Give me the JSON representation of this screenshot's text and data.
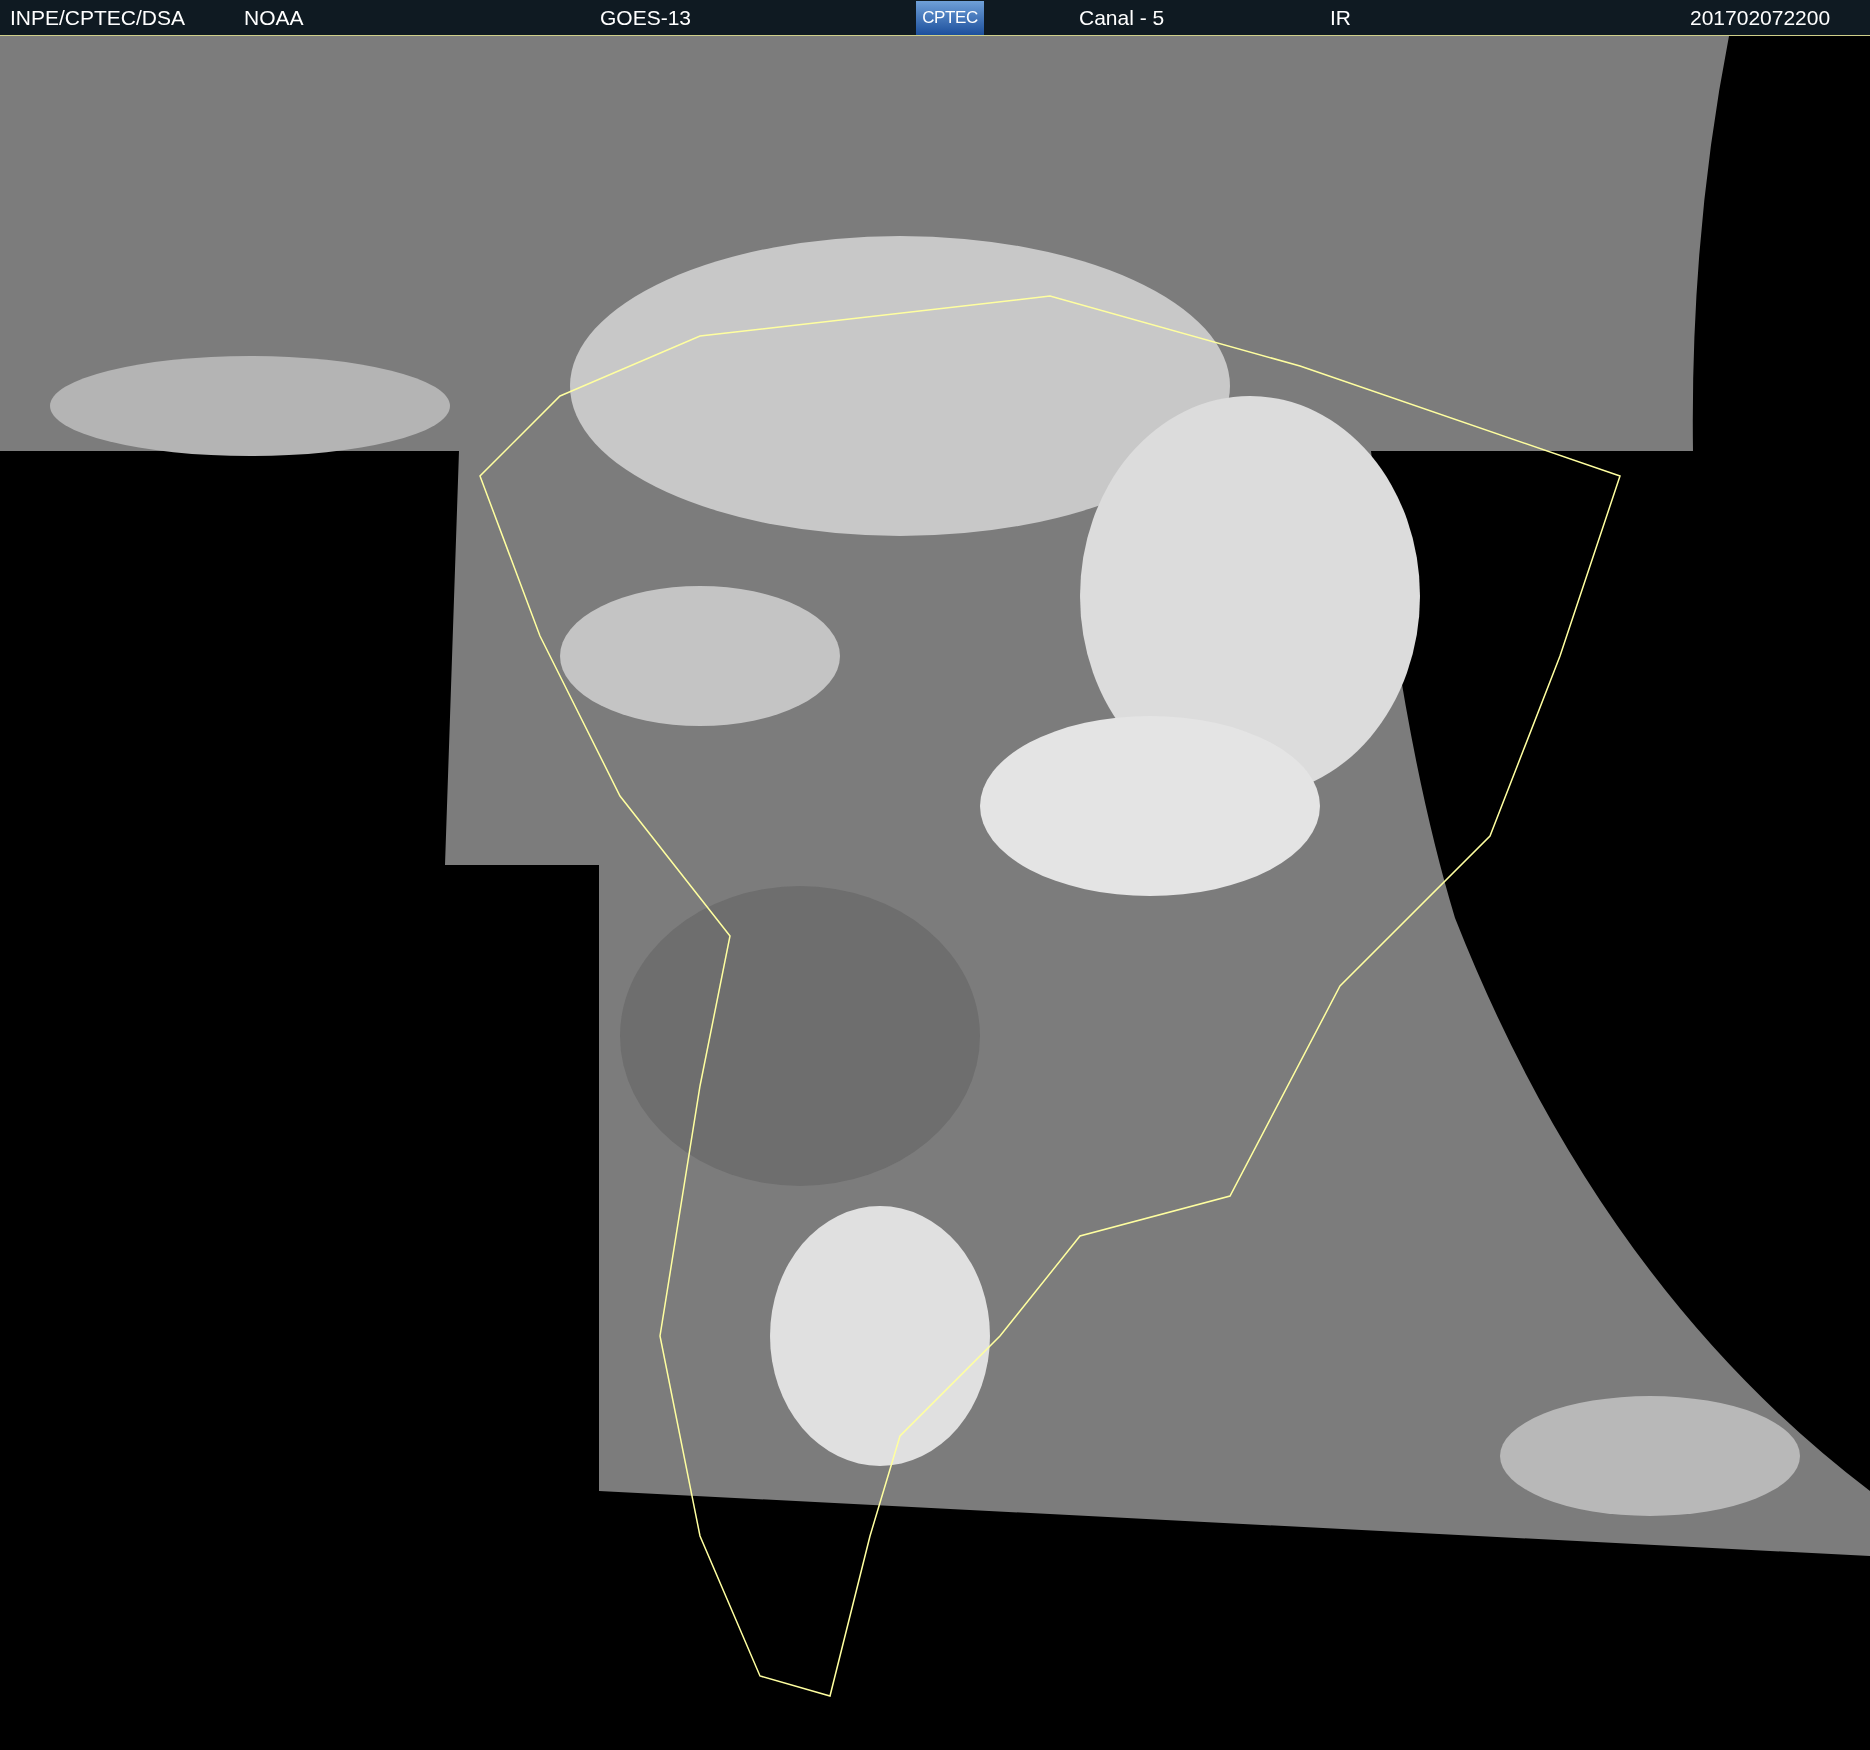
{
  "header": {
    "items": [
      {
        "kind": "text",
        "text": "INPE/CPTEC/DSA"
      },
      {
        "kind": "text",
        "text": "NOAA"
      },
      {
        "kind": "text",
        "text": "GOES-13"
      },
      {
        "kind": "logo",
        "text": "CPTEC"
      },
      {
        "kind": "text",
        "text": "Canal - 5"
      },
      {
        "kind": "text",
        "text": "IR"
      },
      {
        "kind": "text",
        "text": "201702072200"
      }
    ]
  }
}
